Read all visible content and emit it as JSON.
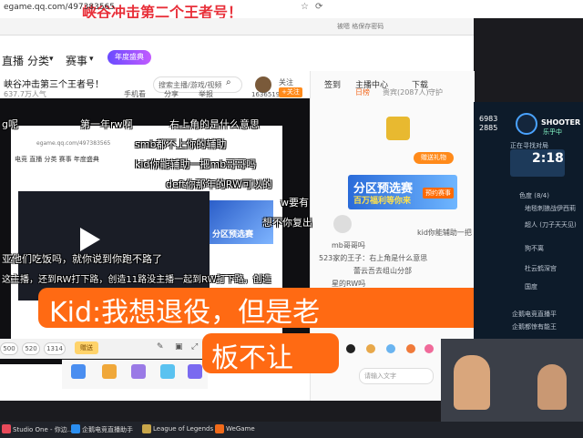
{
  "top_banner": {
    "text": "峡谷冲击第二个王者号！"
  },
  "browser": {
    "url": "egame.qq.com/497383565",
    "address_hint": "被嗯 格保存密码",
    "nav": [
      "直播",
      "分类",
      "赛事"
    ],
    "nav_badges": [
      "▾",
      "▾"
    ],
    "logo_badge": "年度盛典",
    "room_title": "峡谷冲击第三个王者号！",
    "room_sub": "637.7万人气",
    "search_placeholder": "搜索主播/游戏/视频",
    "tools": [
      "手机看",
      "分享",
      "举报"
    ],
    "viewer_count": "1636519",
    "follow_label": "关注",
    "follow_plus": "+关注"
  },
  "side": {
    "tabs": [
      "签到",
      "主播中心",
      "下载"
    ],
    "sub_tabs": [
      "日榜",
      "贵宾(2087人)",
      "守护"
    ],
    "trophy_btn": "赠送礼物",
    "ad_title": "分区预选赛",
    "ad_sub": "百万福利等你来",
    "ad_btn": "预约赛事",
    "chat": [
      "kid你能辅助一把",
      "mb哥哥吗",
      "523家的王子：右上角是什么意思",
      "蕾云吾去组山分部",
      "星的RW吗"
    ]
  },
  "inner": {
    "url": "egame.qq.com/497383565",
    "nav": "电竞  直播  分类  赛事  年度盛典",
    "ad_text": "分区预选赛"
  },
  "danmaku": [
    "g呢",
    "第一年rw啊",
    "右上角的是什么意思",
    "smb都不上你的辅助",
    "kid你能辅助一把mb哥哥吗",
    "deft你那年的RW可以的",
    "w要有",
    "想不你复出",
    "亚他们吃饭吗，就你说到你跑不路了",
    "这主播，还到RW打下路，创造11路没主播一起到RW打下路，创造"
  ],
  "bottom": {
    "pills": [
      "500",
      "520",
      "1314"
    ],
    "gift_btn": "赠送",
    "chat_placeholder": "请输入文字"
  },
  "subtitle": {
    "line1": "Kid:我想退役，但是老",
    "line2": "板不让"
  },
  "game": {
    "score_l1": "6983",
    "score_l2": "2885",
    "shooter": "SHOOTER",
    "shooter_sub": "乐乎中",
    "timer_label": "正在寻找对局",
    "timer": "2:18",
    "lines": [
      "色度 (8/4)",
      "地毯刺狼战伊西莉",
      "超人 (刀子天天见)",
      "狗不离",
      "杜云鹤深宫",
      "国度",
      "企鹅电竞直播平",
      "企鹅都惊有能王"
    ]
  },
  "taskbar": [
    "Studio One - 你边...",
    "企鹅电竞直播助手",
    "League of Legends",
    "WeGame"
  ],
  "colors": {
    "accent": "#ff6a13",
    "banner_red": "#e8303a"
  }
}
